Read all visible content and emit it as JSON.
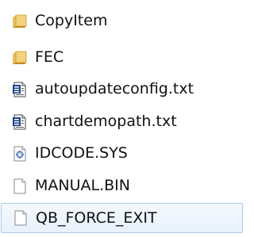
{
  "files": [
    {
      "name": "CopyItem",
      "icon": "folder-icon"
    },
    {
      "name": "FEC",
      "icon": "folder-icon"
    },
    {
      "name": "autoupdateconfig.txt",
      "icon": "text-file-icon"
    },
    {
      "name": "chartdemopath.txt",
      "icon": "text-file-icon"
    },
    {
      "name": "IDCODE.SYS",
      "icon": "system-file-icon"
    },
    {
      "name": "MANUAL.BIN",
      "icon": "blank-file-icon"
    },
    {
      "name": "QB_FORCE_EXIT",
      "icon": "blank-file-icon",
      "selected": true
    }
  ],
  "colors": {
    "folder": "#e6b84a",
    "selection_border": "#a9c9ec",
    "selection_fill": "#e8f1fb"
  }
}
